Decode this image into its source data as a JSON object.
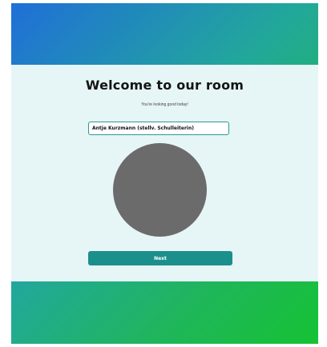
{
  "welcome": {
    "title": "Welcome to our room",
    "subtitle": "You're looking good today!",
    "name_value": "Antje Kurzmann (stellv. Schulleiterin)",
    "next_label": "Next"
  },
  "colors": {
    "accent": "#1b8f8c",
    "panel": "#e6f5f6",
    "gradient_start": "#1f6fd8",
    "gradient_end": "#15c233",
    "avatar_placeholder": "#6b6b6b"
  }
}
